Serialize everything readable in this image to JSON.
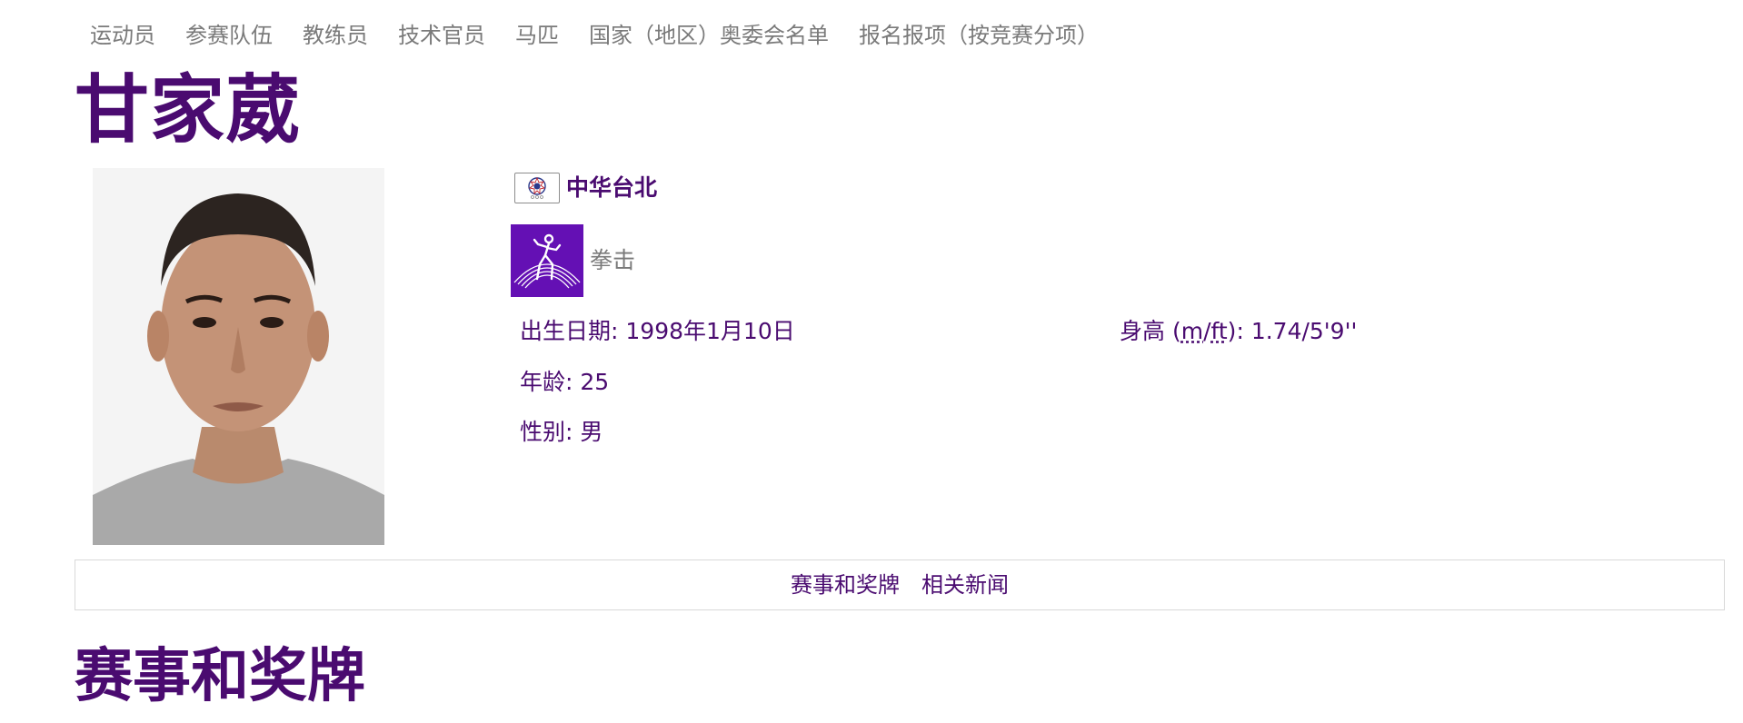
{
  "nav": {
    "items": [
      {
        "label": "运动员"
      },
      {
        "label": "参赛队伍"
      },
      {
        "label": "教练员"
      },
      {
        "label": "技术官员"
      },
      {
        "label": "马匹"
      },
      {
        "label": "国家（地区）奥委会名单"
      },
      {
        "label": "报名报项（按竞赛分项）"
      }
    ]
  },
  "athlete": {
    "name": "甘家葳",
    "photo_icon": "athlete-portrait",
    "noc": {
      "name": "中华台北",
      "flag_icon": "chinese-taipei-flag-icon"
    },
    "sport": {
      "name": "拳击",
      "icon": "boxing-pictogram-icon",
      "icon_color": "#6410b4"
    },
    "birth": {
      "label": "出生日期",
      "value": "1998年1月10日"
    },
    "height": {
      "label_prefix": "身高 (",
      "unit_m": "m",
      "slash": "/",
      "unit_ft": "ft",
      "label_suffix": ")",
      "value": "1.74/5'9''"
    },
    "age": {
      "label": "年龄",
      "value": "25"
    },
    "gender": {
      "label": "性别",
      "value": "男"
    },
    "separator": ": "
  },
  "tabs": [
    {
      "label": "赛事和奖牌"
    },
    {
      "label": "相关新闻"
    }
  ],
  "section": {
    "title": "赛事和奖牌"
  },
  "colors": {
    "accent": "#4a0b70",
    "nav_text": "#7a7a7a",
    "sport_bg": "#6410b4",
    "border": "#d9d9d9"
  }
}
